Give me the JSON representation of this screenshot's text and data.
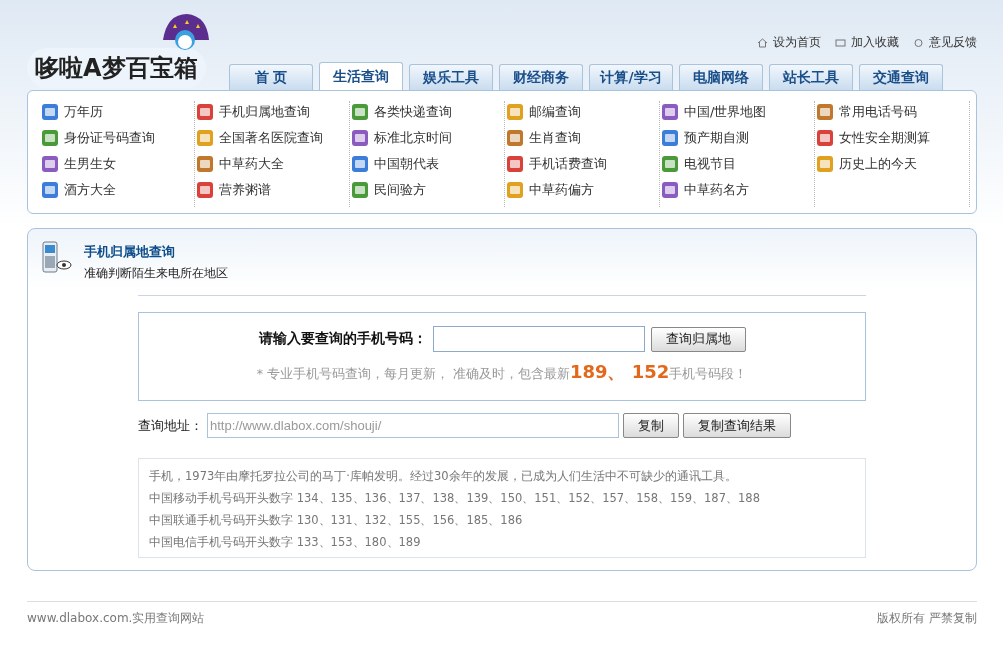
{
  "logo": {
    "text": "哆啦A梦百宝箱"
  },
  "top_links": [
    "设为首页",
    "加入收藏",
    "意见反馈"
  ],
  "tabs": [
    {
      "label": "首 页",
      "selected": false
    },
    {
      "label": "生活查询",
      "selected": true
    },
    {
      "label": "娱乐工具",
      "selected": false
    },
    {
      "label": "财经商务",
      "selected": false
    },
    {
      "label": "计算/学习",
      "selected": false
    },
    {
      "label": "电脑网络",
      "selected": false
    },
    {
      "label": "站长工具",
      "selected": false
    },
    {
      "label": "交通查询",
      "selected": false
    }
  ],
  "link_columns": [
    [
      "万年历",
      "身份证号码查询",
      "生男生女",
      "酒方大全"
    ],
    [
      "手机归属地查询",
      "全国著名医院查询",
      "中草药大全",
      "营养粥谱"
    ],
    [
      "各类快递查询",
      "标准北京时间",
      "中国朝代表",
      "民间验方"
    ],
    [
      "邮编查询",
      "生肖查询",
      "手机话费查询",
      "中草药偏方"
    ],
    [
      "中国/世界地图",
      "预产期自测",
      "电视节目",
      "中草药名方"
    ],
    [
      "常用电话号码",
      "女性安全期测算",
      "历史上的今天"
    ]
  ],
  "tool": {
    "title": "手机归属地查询",
    "subtitle": "准确判断陌生来电所在地区"
  },
  "query": {
    "label": "请输入要查询的手机号码：",
    "button": "查询归属地",
    "hint": [
      {
        "text": "* 专业手机号码查询，每月更新， 准确及时，包含最新",
        "emphasis": false
      },
      {
        "text": "189、 152",
        "emphasis": true
      },
      {
        "text": "手机号码段！",
        "emphasis": false
      }
    ]
  },
  "address": {
    "label": "查询地址：",
    "value": "http://www.dlabox.com/shouji/",
    "buttons": [
      "复制",
      "复制查询结果"
    ]
  },
  "info_lines": [
    "手机，1973年由摩托罗拉公司的马丁·库帕发明。经过30余年的发展，已成为人们生活中不可缺少的通讯工具。",
    "中国移动手机号码开头数字 134、135、136、137、138、139、150、151、152、157、158、159、187、188",
    "中国联通手机号码开头数字 130、131、132、155、156、185、186",
    "中国电信手机号码开头数字 133、153、180、189"
  ],
  "footer": {
    "left": "www.dlabox.com.实用查询网站",
    "right": "版权所有 严禁复制"
  }
}
